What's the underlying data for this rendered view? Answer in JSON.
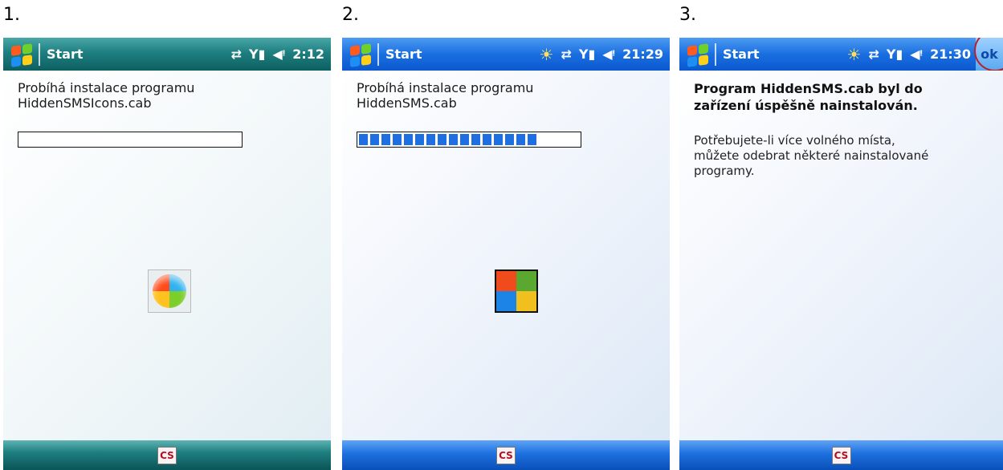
{
  "steps": [
    {
      "number": "1.",
      "titlebar": {
        "start": "Start",
        "time": "2:12"
      },
      "message_lines": [
        "Probíhá instalace programu",
        "HiddenSMSIcons.cab"
      ],
      "progress_segments": 0,
      "bottom": {
        "ime": "CS"
      }
    },
    {
      "number": "2.",
      "titlebar": {
        "start": "Start",
        "time": "21:29"
      },
      "message_lines": [
        "Probíhá instalace programu",
        "HiddenSMS.cab"
      ],
      "progress_segments": 16,
      "bottom": {
        "ime": "CS"
      }
    },
    {
      "number": "3.",
      "titlebar": {
        "start": "Start",
        "time": "21:30",
        "ok": "ok"
      },
      "title_lines": [
        "Program HiddenSMS.cab byl do",
        "zařízení úspěšně nainstalován."
      ],
      "body_lines": [
        "Potřebujete-li více volného místa,",
        "můžete odebrat některé nainstalované",
        "programy."
      ],
      "bottom": {
        "ime": "CS"
      }
    }
  ],
  "icons": {
    "start_flag": "windows-flag-icon",
    "sync": "sync-arrows-icon",
    "signal": "signal-strength-icon",
    "volume": "speaker-icon",
    "alarm": "notification-bell-icon",
    "install_ball": "install-ball-icon",
    "install_square": "install-windows-logo-icon"
  },
  "colors": {
    "teal_bar": "#1e7f80",
    "blue_bar": "#1a6fe0",
    "progress_fill": "#1d6fe2",
    "highlight_circle": "#b9202a"
  }
}
